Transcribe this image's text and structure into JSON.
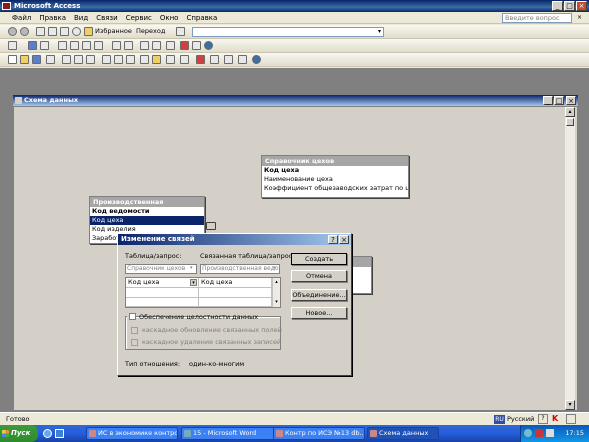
{
  "app": {
    "title": "Microsoft Access"
  },
  "menubar": {
    "items": [
      "Файл",
      "Правка",
      "Вид",
      "Связи",
      "Сервис",
      "Окно",
      "Справка"
    ],
    "help_placeholder": "Введите вопрос"
  },
  "web_toolbar": {
    "favorites": "Избранное",
    "goto": "Переход"
  },
  "relwin": {
    "title": "Схема данных"
  },
  "tables": {
    "spravochnik": {
      "title": "Справочник цехов",
      "fields": [
        "Код цеха",
        "Наименование цеха",
        "Коэффициент общезаводских затрат по цеху"
      ]
    },
    "proizv": {
      "title": "Производственная ведомость",
      "fields": [
        "Код ведомости",
        "Код цеха",
        "Код изделия",
        "Заработ"
      ]
    }
  },
  "dialog": {
    "title": "Изменение связей",
    "help": "?",
    "close": "×",
    "label_table": "Таблица/запрос:",
    "label_related": "Связанная таблица/запрос:",
    "combo_table": "Справочник цехов",
    "combo_related": "Производственная ведо",
    "grid_rows": [
      [
        "Код цеха",
        "Код цеха"
      ],
      [
        "",
        ""
      ],
      [
        "",
        ""
      ]
    ],
    "buttons": {
      "create": "Создать",
      "cancel": "Отмена",
      "join": "Объединение...",
      "new": "Новое..."
    },
    "integrity": "Обеспечение целостности данных",
    "cascade_update": "каскадное обновление связанных полей",
    "cascade_delete": "каскадное удаление связанных записей",
    "rel_type_label": "Тип отношения:",
    "rel_type_value": "один-ко-многим"
  },
  "status": {
    "text": "Готово",
    "lang_code": "RU",
    "lang_name": "Русский"
  },
  "taskbar": {
    "start": "Пуск",
    "tasks": [
      "ИС в экономике контро...",
      "15 - Microsoft Word",
      "Контр по ИСЭ №13 db...",
      "Схема данных"
    ],
    "time": "17:15"
  },
  "colors": {
    "titlebar": "#0A246A",
    "selection": "#0A246A",
    "taskbar": "#245EDC",
    "start": "#2E8B2E"
  }
}
